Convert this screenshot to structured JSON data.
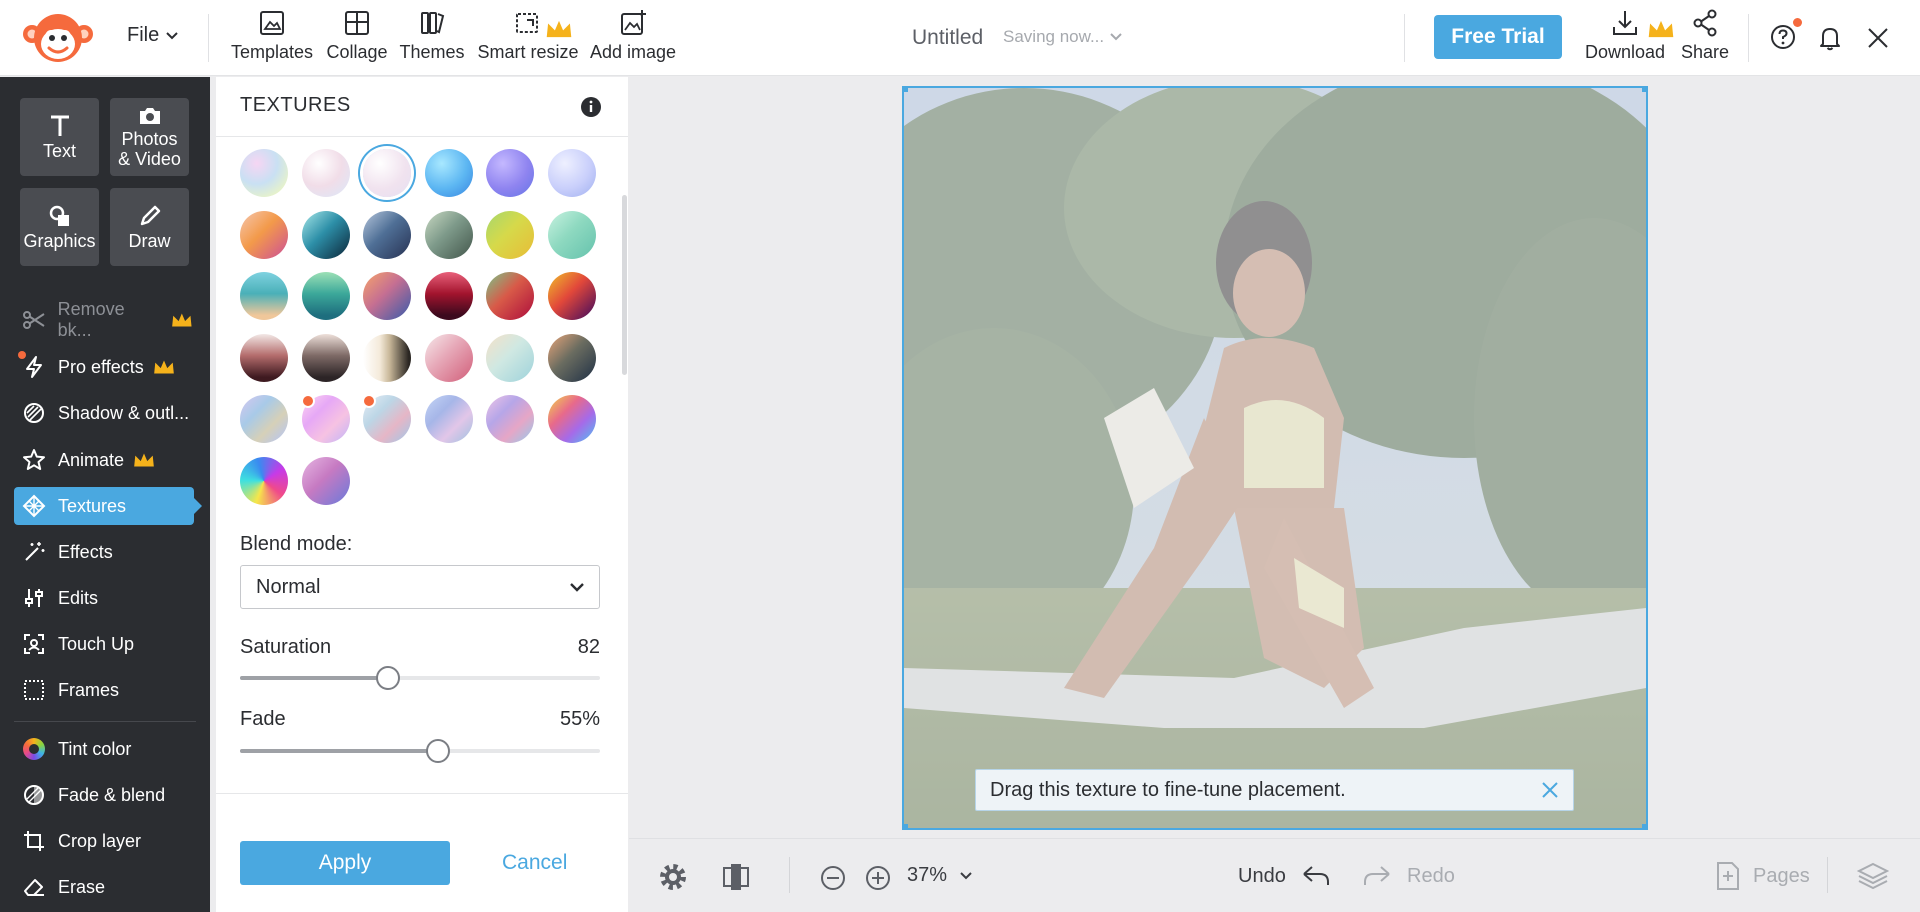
{
  "app": {
    "file_menu_label": "File"
  },
  "toolbar": {
    "items": [
      {
        "label": "Templates",
        "icon": "templates-icon"
      },
      {
        "label": "Collage",
        "icon": "collage-icon"
      },
      {
        "label": "Themes",
        "icon": "themes-icon"
      },
      {
        "label": "Smart resize",
        "icon": "smart-resize-icon",
        "premium": true
      },
      {
        "label": "Add image",
        "icon": "add-image-icon"
      }
    ]
  },
  "document": {
    "title": "Untitled",
    "save_status": "Saving now..."
  },
  "header_right": {
    "free_trial_label": "Free Trial",
    "download_label": "Download",
    "share_label": "Share"
  },
  "left_tiles": [
    {
      "label": "Text",
      "icon": "text-icon"
    },
    {
      "label_line1": "Photos",
      "label_line2": "& Video",
      "icon": "camera-icon"
    },
    {
      "label": "Graphics",
      "icon": "graphics-icon"
    },
    {
      "label": "Draw",
      "icon": "pen-icon"
    }
  ],
  "left_nav": [
    {
      "label": "Remove bk...",
      "icon": "scissors-icon",
      "disabled": true,
      "premium": true
    },
    {
      "label": "Pro effects",
      "icon": "lightning-icon",
      "premium": true,
      "new_dot": true
    },
    {
      "label": "Shadow & outl...",
      "icon": "shadow-outline-icon"
    },
    {
      "label": "Animate",
      "icon": "star-icon",
      "premium": true
    },
    {
      "label": "Textures",
      "icon": "texture-icon",
      "active": true
    },
    {
      "label": "Effects",
      "icon": "magic-wand-icon"
    },
    {
      "label": "Edits",
      "icon": "sliders-icon"
    },
    {
      "label": "Touch Up",
      "icon": "face-scan-icon"
    },
    {
      "label": "Frames",
      "icon": "frame-icon"
    },
    {
      "label": "Tint color",
      "icon": "color-wheel-icon"
    },
    {
      "label": "Fade & blend",
      "icon": "fade-blend-icon"
    },
    {
      "label": "Crop layer",
      "icon": "crop-icon"
    },
    {
      "label": "Erase",
      "icon": "eraser-icon"
    }
  ],
  "textures_panel": {
    "title": "TEXTURES",
    "selected_index": 2,
    "swatches": [
      "radial-gradient(circle at 35% 30%, #f6d6f3, #c9e0f3 45%, #e8f3c9 80%)",
      "radial-gradient(circle at 35% 30%, #ffffff, #f1dde8 50%, #dfe6f6 90%)",
      "radial-gradient(circle at 35% 30%, #ffffff, #f1e3ef 55%, #e8dff0 90%)",
      "radial-gradient(circle at 35% 30%, #a8e8ff, #5cb6f2 55%, #3f8fe4 90%)",
      "radial-gradient(circle at 35% 30%, #c4b8ff, #8f84f0 55%, #6d78e8 90%)",
      "radial-gradient(circle at 35% 30%, #eef0ff, #c9cffb 55%, #a8b6f2 90%)",
      "linear-gradient(135deg, #f5c6b0 0%, #f39a4a 45%, #d35c8a 90%)",
      "linear-gradient(135deg, #a8e8e8 0%, #2d8fa8 45%, #12384c 90%)",
      "linear-gradient(135deg, #b6c6dc 0%, #4f6f96 45%, #2e3c5e 90%)",
      "linear-gradient(135deg, #c9d9c2 0%, #7e9a8a 45%, #4d6256 90%)",
      "linear-gradient(135deg, #a6d86e 0%, #d6d94a 45%, #e5c13a 90%)",
      "linear-gradient(135deg, #c8f2e0 0%, #8ed9c0 45%, #6cc6b0 90%)",
      "linear-gradient(180deg, #7fd2e0 0%, #4ab0b8 45%, #f0c79a 90%)",
      "linear-gradient(180deg, #9ce0b6 0%, #3ca89a 45%, #1e6e7e 90%)",
      "linear-gradient(135deg, #f7a46a 0%, #c56f92 45%, #4f5ea6 90%)",
      "linear-gradient(180deg, #e8607a 0%, #a3142e 45%, #3c0a1e 90%)",
      "linear-gradient(135deg, #79c68a 0%, #d85a48 45%, #b41a3e 90%)",
      "linear-gradient(135deg, #f0c02a 0%, #e2483a 45%, #5a1458 90%)",
      "linear-gradient(180deg, #f2e8e6 0%, #b46c6c 45%, #3e1a20 90%)",
      "linear-gradient(180deg, #eee0da 0%, #7e6a66 45%, #2c2426 90%)",
      "linear-gradient(90deg, #ffffff 0%, #f4eada 35%, #c9b89a 55%, #2a2622 95%)",
      "linear-gradient(135deg, #f6e8ea 0%, #e6a6b6 45%, #d56b84 90%)",
      "linear-gradient(135deg, #f5e1c8 0%, #cfe8e2 45%, #a6d6dc 90%)",
      "linear-gradient(135deg, #e8a57a 0%, #6a6c60 45%, #2c3a4a 90%)",
      "linear-gradient(135deg, #d8c8f0 0%, #a8cae8 35%, #d6d0b8 65%, #b6c6f2 95%)",
      "linear-gradient(135deg, #ffd6f0 0%, #e6a8f6 35%, #f6c2e2 65%, #c6b6f6 95%)",
      "linear-gradient(135deg, #e8eef6 0%, #bcd6e6 35%, #e6b6c6 65%, #a6c6e6 95%)",
      "linear-gradient(135deg, #c6d6f6 0%, #a6b6e8 35%, #e2c6e8 65%, #a6c2e2 95%)",
      "linear-gradient(135deg, #f0c6e6 0%, #b6a6e8 35%, #e6a6c6 65%, #9ec6e8 95%)",
      "linear-gradient(135deg, #f2d74a 0%, #e86a8a 35%, #a66ae8 65%, #5ab6f0 95%)",
      "conic-gradient(from 200deg, #f6e64a, #3ee0e0, #3a8af0, #c63ae8, #f04a8a, #f6e64a)",
      "linear-gradient(135deg, #e6b6e2 0%, #c67ac2 45%, #7a7ad6 90%)"
    ],
    "swatch_dots": [
      25,
      26
    ],
    "blend_mode_label": "Blend mode:",
    "blend_mode_value": "Normal",
    "saturation_label": "Saturation",
    "saturation_value": "82",
    "saturation_fraction": 0.41,
    "fade_label": "Fade",
    "fade_value": "55%",
    "fade_fraction": 0.55,
    "apply_label": "Apply",
    "cancel_label": "Cancel"
  },
  "canvas": {
    "toast_text": "Drag this texture to fine-tune placement."
  },
  "bottom_bar": {
    "zoom_value": "37%",
    "undo_label": "Undo",
    "redo_label": "Redo",
    "pages_label": "Pages"
  },
  "colors": {
    "accent": "#4aa8e0",
    "dark_nav": "#2b2d31",
    "premium": "#f5b21b",
    "notification": "#f56a3d"
  }
}
